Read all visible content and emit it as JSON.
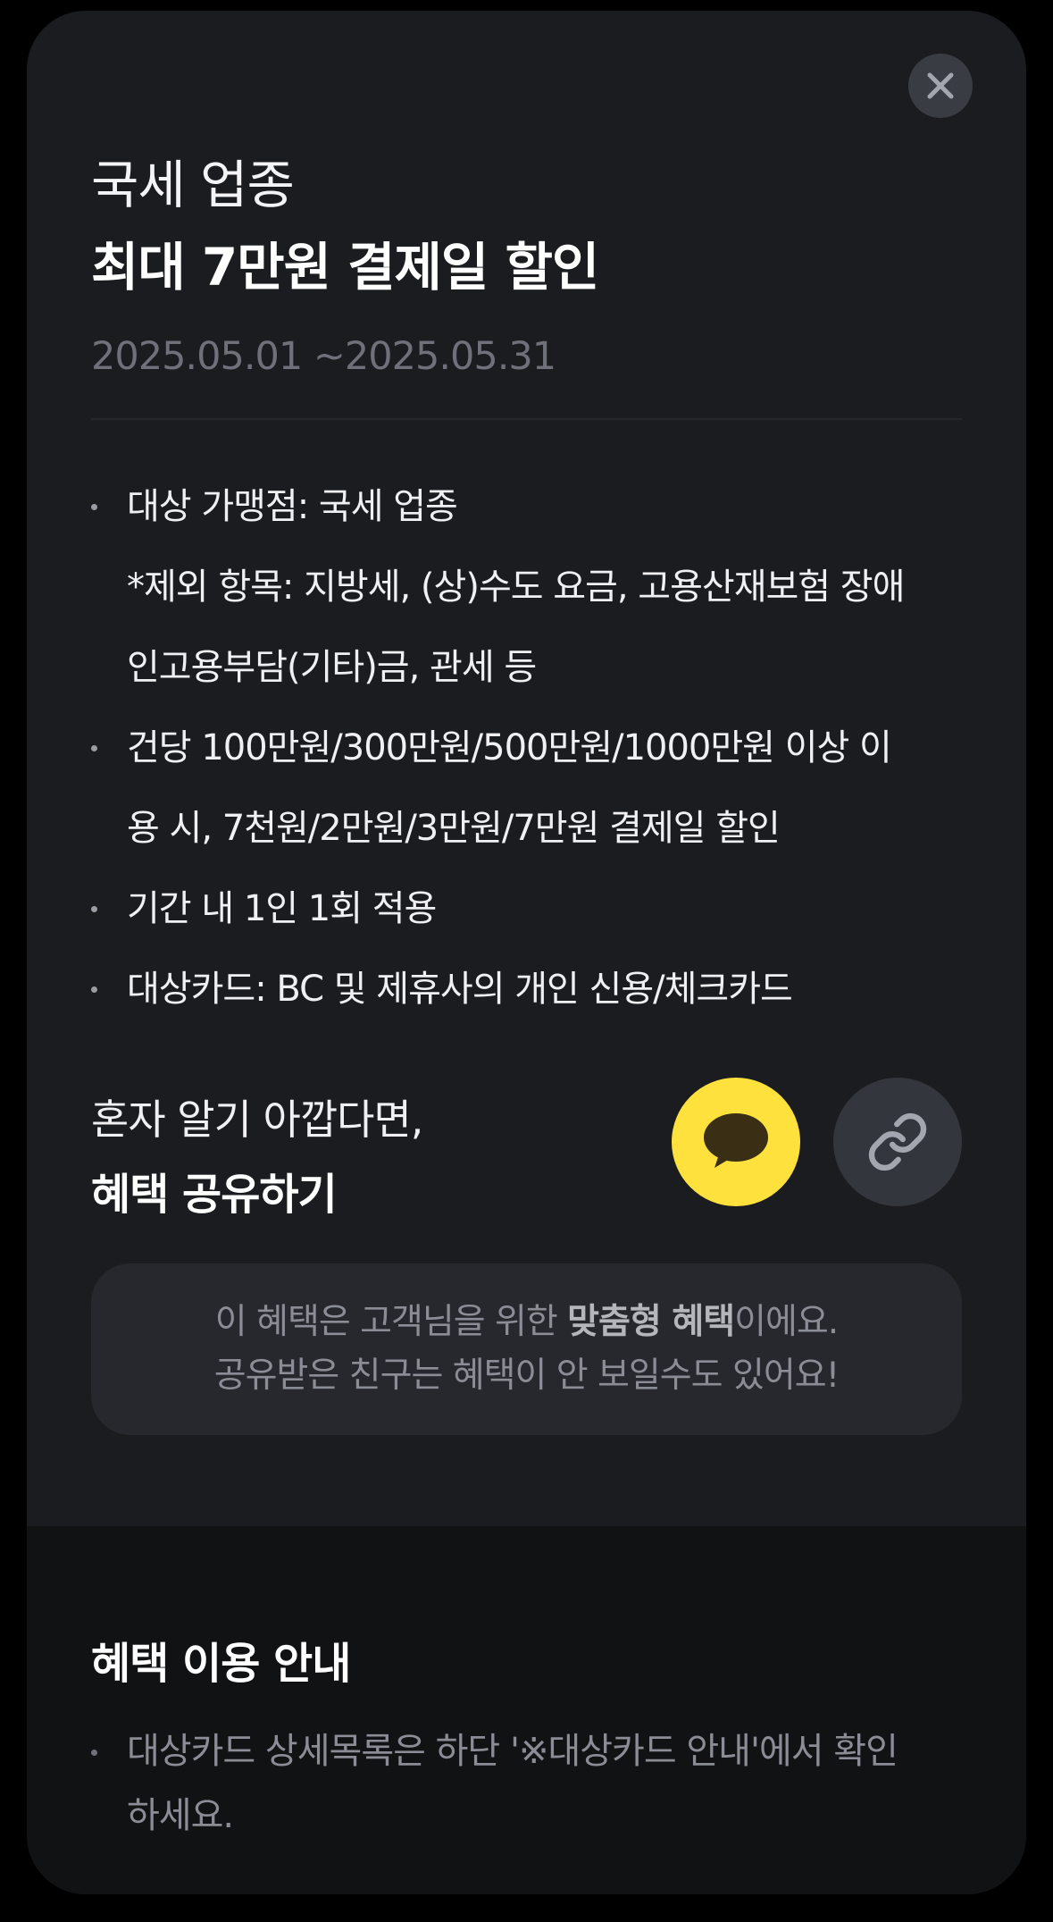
{
  "header": {
    "title_line1": "국세 업종",
    "title_line2": "최대 7만원 결제일 할인",
    "period": "2025.05.01 ~2025.05.31"
  },
  "benefit_details": [
    {
      "lines": [
        "대상 가맹점: 국세 업종",
        "*제외 항목: 지방세, (상)수도 요금, 고용산재보험 장애",
        "인고용부담(기타)금, 관세 등"
      ]
    },
    {
      "lines": [
        "건당 100만원/300만원/500만원/1000만원 이상 이",
        "용 시, 7천원/2만원/3만원/7만원 결제일 할인"
      ]
    },
    {
      "lines": [
        "기간 내 1인 1회 적용"
      ]
    },
    {
      "lines": [
        "대상카드: BC 및 제휴사의 개인 신용/체크카드"
      ]
    }
  ],
  "share": {
    "question": "혼자 알기 아깝다면,",
    "title": "혜택 공유하기",
    "kakao_icon": "kakao-chat-icon",
    "link_icon": "link-icon"
  },
  "notice": {
    "line1_prefix": "이 혜택은 고객님을 위한 ",
    "line1_bold": "맞춤형 혜택",
    "line1_suffix": "이에요.",
    "line2": "공유받은 친구는 혜택이 안 보일수도 있어요!"
  },
  "guide": {
    "title": "혜택 이용 안내",
    "items": [
      {
        "lines": [
          "대상카드 상세목록은 하단 '※대상카드 안내'에서 확인",
          "하세요."
        ]
      }
    ]
  },
  "colors": {
    "sheet_bg": "#1b1c1f",
    "guide_bg": "#111214",
    "kakao_yellow": "#fee13d",
    "muted_text": "#8a8d95"
  }
}
